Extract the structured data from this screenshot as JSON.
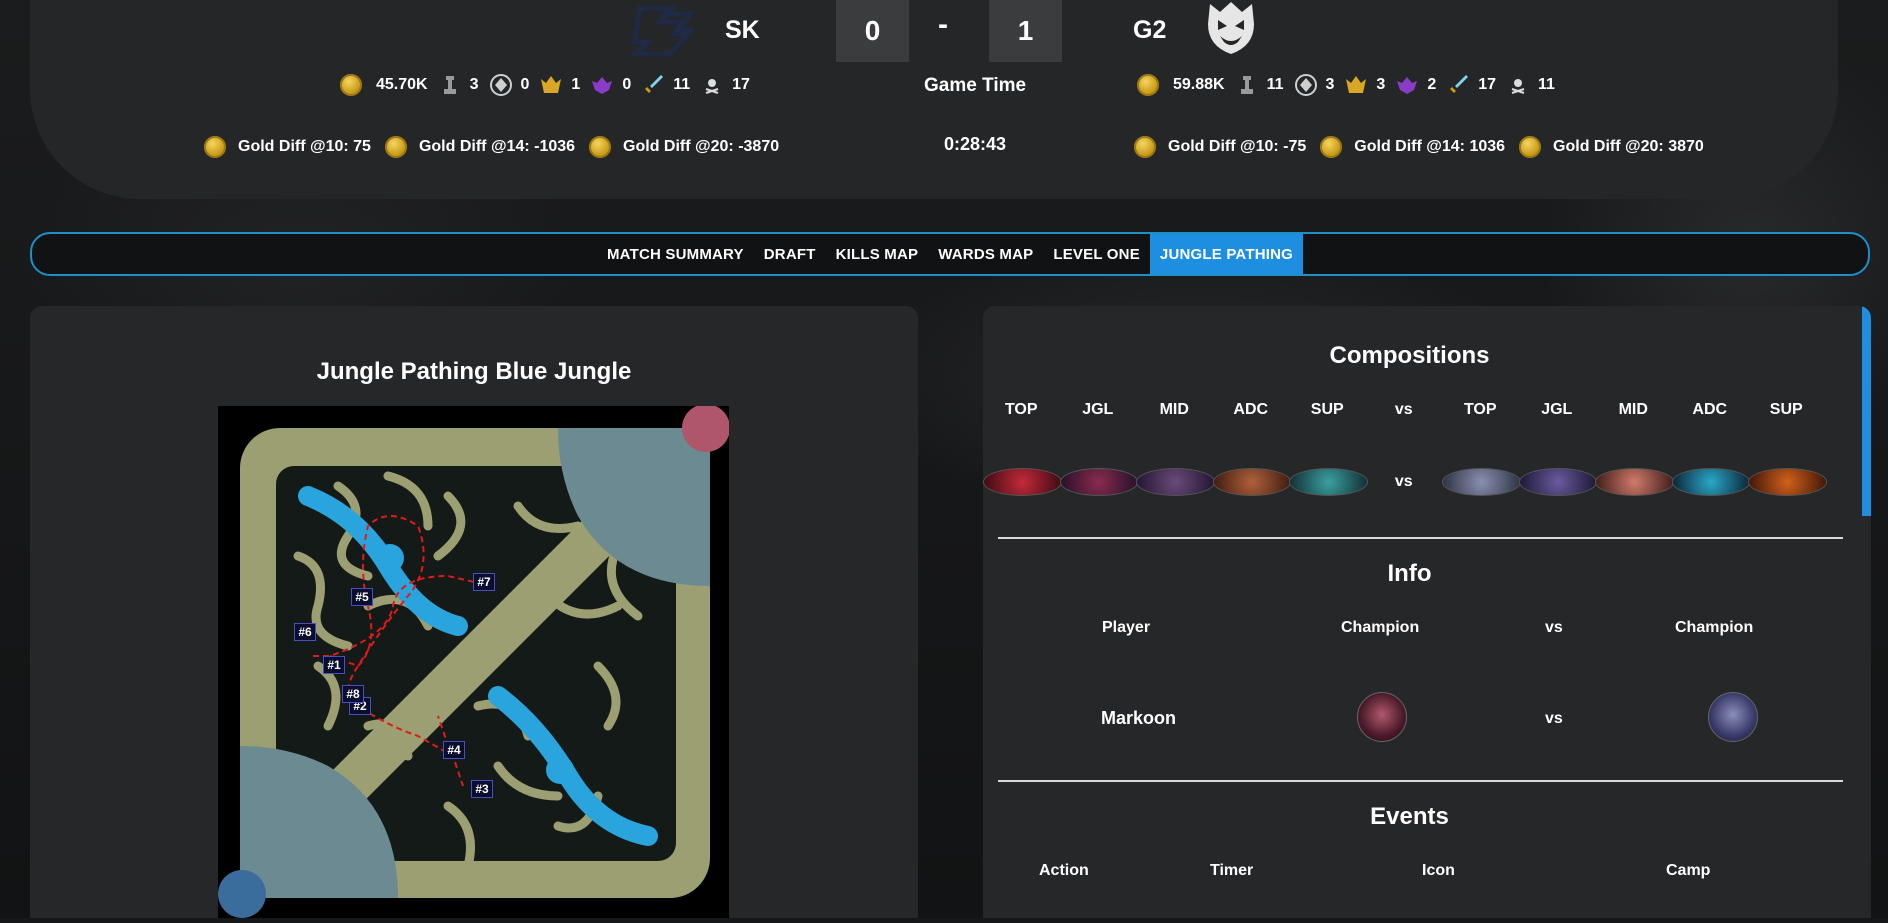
{
  "header": {
    "left_team": {
      "name": "SK",
      "score": "0",
      "stats": [
        {
          "icon": "gold-icon",
          "value": "45.70K"
        },
        {
          "icon": "tower-icon",
          "value": "3"
        },
        {
          "icon": "inhibitor-icon",
          "value": "0"
        },
        {
          "icon": "baron-icon",
          "value": "1"
        },
        {
          "icon": "dragon-icon",
          "value": "0"
        },
        {
          "icon": "kills-icon",
          "value": "11"
        },
        {
          "icon": "deaths-icon",
          "value": "17"
        }
      ],
      "gold_diffs": [
        "Gold Diff @10: 75",
        "Gold Diff @14: -1036",
        "Gold Diff @20: -3870"
      ]
    },
    "right_team": {
      "name": "G2",
      "score": "1",
      "stats": [
        {
          "icon": "gold-icon",
          "value": "59.88K"
        },
        {
          "icon": "tower-icon",
          "value": "11"
        },
        {
          "icon": "inhibitor-icon",
          "value": "3"
        },
        {
          "icon": "baron-icon",
          "value": "3"
        },
        {
          "icon": "dragon-icon",
          "value": "2"
        },
        {
          "icon": "kills-icon",
          "value": "17"
        },
        {
          "icon": "deaths-icon",
          "value": "11"
        }
      ],
      "gold_diffs": [
        "Gold Diff @10: -75",
        "Gold Diff @14: 1036",
        "Gold Diff @20: 3870"
      ]
    },
    "dash": "-",
    "game_time_label": "Game Time",
    "game_time": "0:28:43"
  },
  "nav": {
    "tabs": [
      "MATCH SUMMARY",
      "DRAFT",
      "KILLS MAP",
      "WARDS MAP",
      "LEVEL ONE",
      "JUNGLE PATHING"
    ],
    "active": "JUNGLE PATHING"
  },
  "left_panel": {
    "title": "Jungle Pathing Blue Jungle",
    "markers": [
      "#1",
      "#2",
      "#3",
      "#4",
      "#5",
      "#6",
      "#7",
      "#8"
    ]
  },
  "right_panel": {
    "compositions_title": "Compositions",
    "roles": [
      "TOP",
      "JGL",
      "MID",
      "ADC",
      "SUP",
      "vs",
      "TOP",
      "JGL",
      "MID",
      "ADC",
      "SUP"
    ],
    "vs": "vs",
    "info_title": "Info",
    "info_headers": [
      "Player",
      "Champion",
      "vs",
      "Champion"
    ],
    "player": "Markoon",
    "events_title": "Events",
    "event_headers": [
      "Action",
      "Timer",
      "Icon",
      "Camp"
    ]
  },
  "colors": {
    "accent": "#1e8fe0",
    "nav_border": "#1e8fc7",
    "path": "#e01a1a",
    "river": "#2aa4dd"
  }
}
